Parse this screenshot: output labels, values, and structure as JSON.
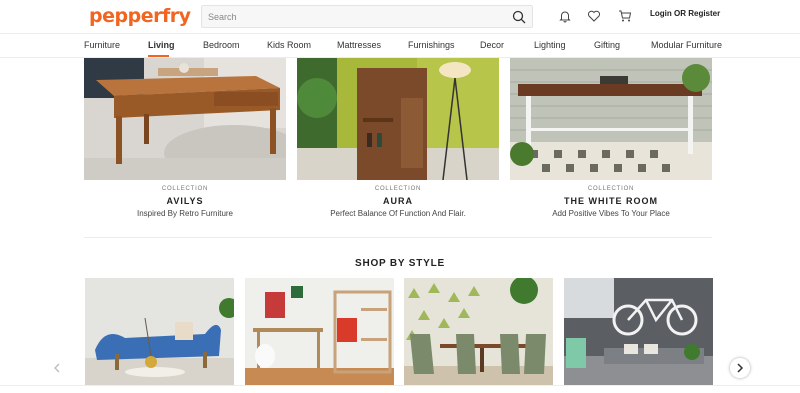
{
  "header": {
    "logo_text": "pepperfry",
    "search_placeholder": "Search",
    "login_label": "Login OR Register",
    "icons": [
      "search-icon",
      "bell-icon",
      "heart-icon",
      "cart-icon"
    ]
  },
  "nav": {
    "items": [
      "Furniture",
      "Living",
      "Bedroom",
      "Kids Room",
      "Mattresses",
      "Furnishings",
      "Decor",
      "Lighting",
      "Gifting",
      "Modular Furniture"
    ],
    "active": "Living"
  },
  "collections": [
    {
      "label": "COLLECTION",
      "title": "AVILYS",
      "subtitle": "Inspired By Retro Furniture"
    },
    {
      "label": "COLLECTION",
      "title": "AURA",
      "subtitle": "Perfect Balance Of Function And Flair."
    },
    {
      "label": "COLLECTION",
      "title": "THE WHITE ROOM",
      "subtitle": "Add Positive Vibes To Your Place"
    }
  ],
  "shop_by_style": {
    "title": "SHOP BY STYLE"
  },
  "colors": {
    "brand": "#f16521",
    "text": "#333333"
  }
}
